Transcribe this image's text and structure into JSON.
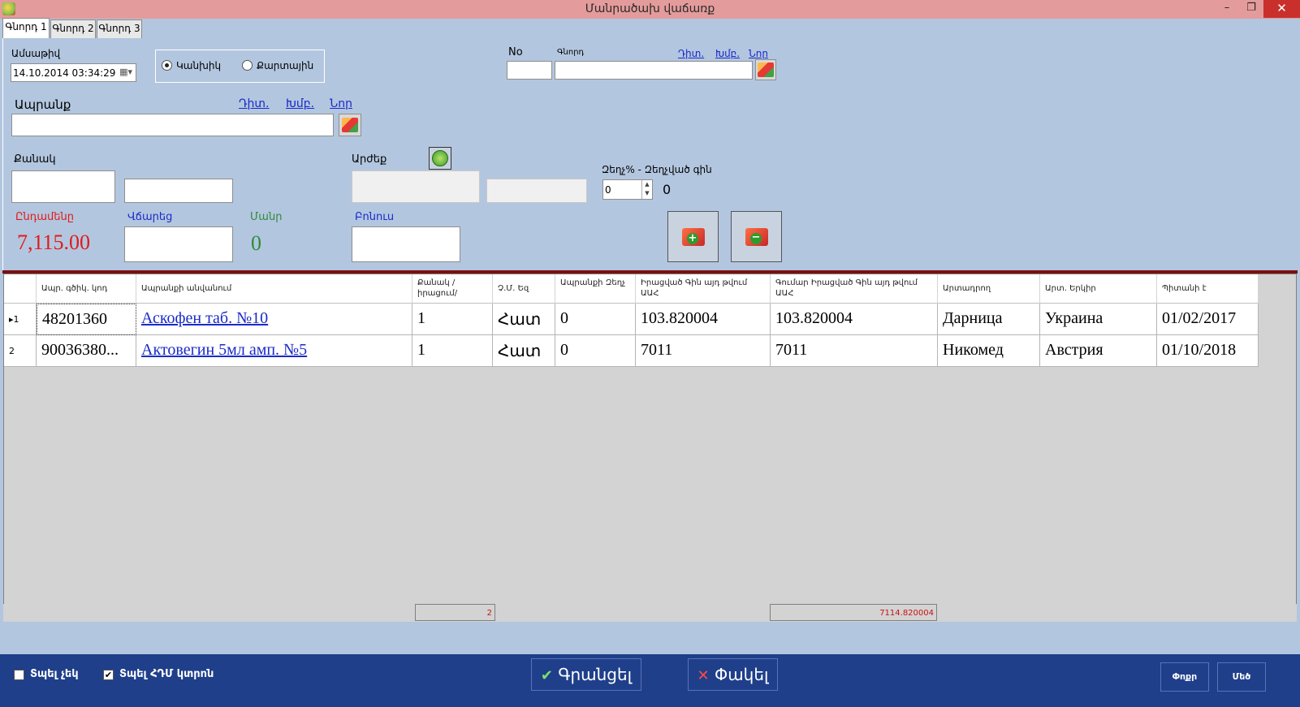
{
  "window": {
    "title": "Մանրածախ վաճառք",
    "minimize_glyph": "–",
    "restore_glyph": "❐",
    "close_glyph": "✕"
  },
  "tabs": [
    {
      "label": "Գնորդ 1",
      "active": true
    },
    {
      "label": "Գնորդ 2",
      "active": false
    },
    {
      "label": "Գնորդ 3",
      "active": false
    }
  ],
  "form": {
    "date_label": "Ամսաթիվ",
    "date_value": "14.10.2014 03:34:29",
    "payment_cash_label": "Կանխիկ",
    "payment_card_label": "Քարտային",
    "payment_selected": "Կանխիկ",
    "no_label": "No",
    "no_value": "",
    "buyer_label": "Գնորդ",
    "buyer_value": "",
    "buyer_view_link": "Դիտ.",
    "buyer_edit_link": "Խմբ.",
    "buyer_new_link": "Նոր",
    "product_label": "Ապրանք",
    "product_value": "",
    "product_view_link": "Դիտ.",
    "product_edit_link": "Խմբ.",
    "product_new_link": "Նոր",
    "quantity_label": "Քանակ",
    "quantity_value": "",
    "quantity_unit_value": "",
    "value_label": "Արժեք",
    "value_value": "",
    "value_extra_value": "",
    "discount_label": "Զեղչ% - Զեղչված գին",
    "discount_percent": "0",
    "discounted_price": "0",
    "total_label": "Ընդամենը",
    "total_value": "7,115.00",
    "paid_label": "Վճարեց",
    "paid_value": "",
    "change_label": "Մանր",
    "change_value": "0",
    "bonus_label": "Բոնուս",
    "bonus_value": ""
  },
  "grid": {
    "columns": [
      "",
      "Ապր. գծիկ. կոդ",
      "Ապրանքի անվանում",
      "Քանակ /իրացում/",
      "Չ.Մ. Եզ",
      "Ապրանքի Զեղչ",
      "Իրացված Գին այդ թվում ԱԱՀ",
      "Գումար Իրացված Գին այդ թվում ԱԱՀ",
      "Արտադրող",
      "Արտ. Երկիր",
      "Պիտանի է"
    ],
    "rows": [
      {
        "marker": "▸1",
        "barcode": "48201360",
        "name": "Аскофен таб. №10",
        "qty": "1",
        "unit": "Հատ",
        "discount": "0",
        "price": "103.820004",
        "sum": "103.820004",
        "maker": "Дарница",
        "country": "Украина",
        "expiry": "01/02/2017"
      },
      {
        "marker": "2",
        "barcode": "90036380...",
        "name": "Актовегин 5мл амп. №5",
        "qty": "1",
        "unit": "Հատ",
        "discount": "0",
        "price": "7011",
        "sum": "7011",
        "maker": "Никомед",
        "country": "Австрия",
        "expiry": "01/10/2018"
      }
    ],
    "total_qty": "2",
    "total_sum": "7114.820004"
  },
  "bottom": {
    "print_check_label": "Տպել չեկ",
    "print_check_checked": false,
    "print_fiscal_label": "Տպել ՀԴՄ կտրոն",
    "print_fiscal_checked": true,
    "register_label": "Գրանցել",
    "close_label": "Փակել",
    "small_btn_1": "Փոքր",
    "small_btn_2": "Մեծ"
  },
  "colors": {
    "title_bar": "#e49b9b",
    "panel": "#b3c6df",
    "bottom_bar": "#1f3f8a",
    "total_red": "#e01a1a",
    "change_green": "#2e8b3a",
    "link_blue": "#1a2bc8"
  }
}
